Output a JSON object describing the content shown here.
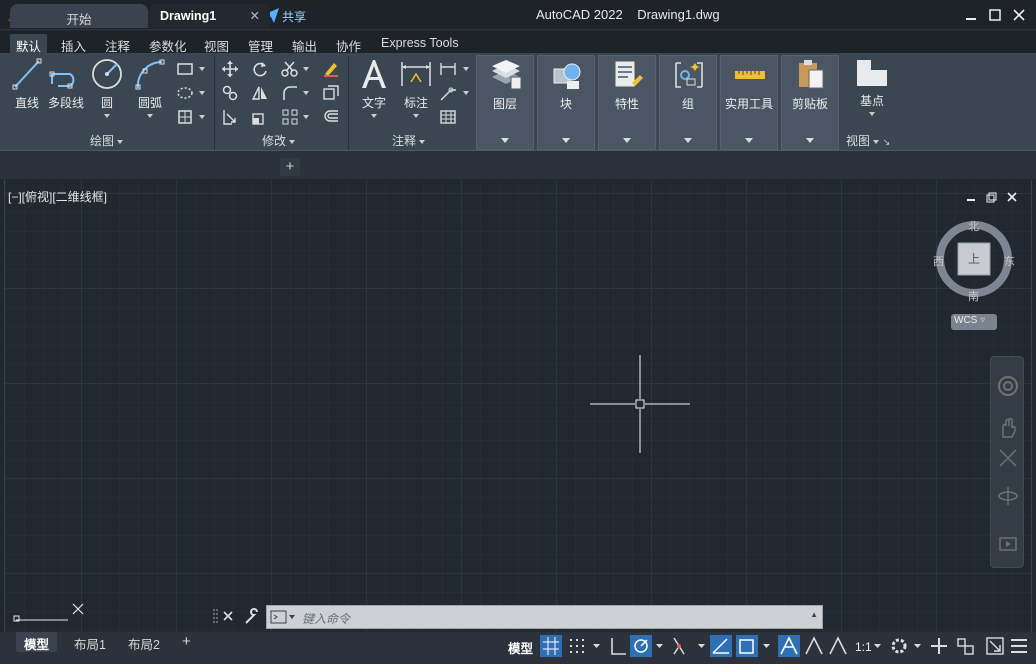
{
  "title": {
    "app": "AutoCAD 2022",
    "doc": "Drawing1.dwg"
  },
  "quick_access": {
    "share": "共享"
  },
  "ribbon_tabs": [
    "默认",
    "插入",
    "注释",
    "参数化",
    "视图",
    "管理",
    "输出",
    "协作",
    "Express Tools"
  ],
  "draw_group": {
    "line": "直线",
    "polyline": "多段线",
    "circle": "圆",
    "arc": "圆弧",
    "footer": "绘图"
  },
  "modify_group": {
    "footer": "修改"
  },
  "annotation_group": {
    "text": "文字",
    "dimension": "标注",
    "footer": "注释"
  },
  "panels": {
    "layers": "图层",
    "block": "块",
    "properties": "特性",
    "groups": "组",
    "utilities": "实用工具",
    "clipboard": "剪贴板"
  },
  "view_group": {
    "base": "基点",
    "footer": "视图"
  },
  "doc_tabs": {
    "start": "开始",
    "drawing": "Drawing1",
    "close": "✕",
    "add": "+"
  },
  "viewport_label": "[−][俯视][二维线框]",
  "viewcube": {
    "n": "北",
    "s": "南",
    "e": "东",
    "w": "西",
    "top": "上",
    "wcs": "WCS"
  },
  "command": {
    "placeholder": "键入命令"
  },
  "layout_tabs": {
    "model": "模型",
    "layout1": "布局1",
    "layout2": "布局2",
    "add": "+"
  },
  "status": {
    "model": "模型",
    "scale": "1:1"
  }
}
